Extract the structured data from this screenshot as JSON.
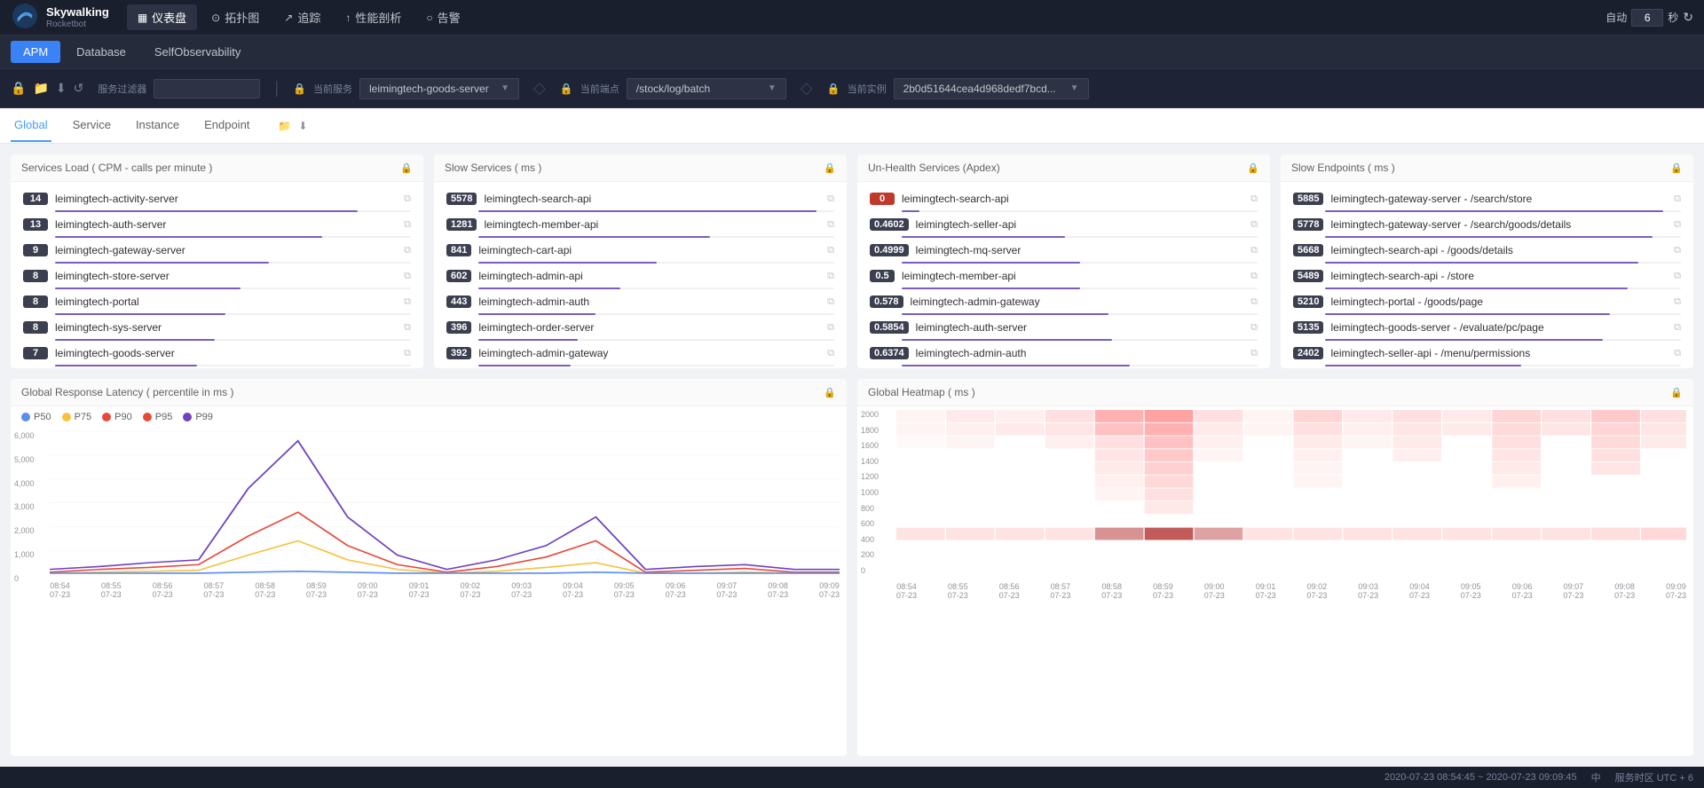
{
  "app": {
    "logo": "Skywalking",
    "logo_sub": "Rocketbot"
  },
  "top_nav": {
    "items": [
      {
        "id": "dashboard",
        "label": "仪表盘",
        "icon": "▦",
        "active": true
      },
      {
        "id": "topology",
        "label": "拓扑图",
        "icon": "⊙"
      },
      {
        "id": "trace",
        "label": "追踪",
        "icon": "↗"
      },
      {
        "id": "performance",
        "label": "性能剖析",
        "icon": "↑"
      },
      {
        "id": "alert",
        "label": "告警",
        "icon": "○"
      }
    ],
    "auto_label": "自动",
    "seconds_label": "秒",
    "refresh_label": "刷新",
    "refresh_value": "6"
  },
  "secondary_nav": {
    "items": [
      {
        "id": "apm",
        "label": "APM",
        "active": true
      },
      {
        "id": "database",
        "label": "Database"
      },
      {
        "id": "self",
        "label": "SelfObservability"
      }
    ]
  },
  "filter_bar": {
    "service_filter_label": "服务过滤器",
    "current_service_label": "当前服务",
    "current_service_value": "leimingtech-goods-server",
    "current_endpoint_label": "当前端点",
    "current_endpoint_value": "/stock/log/batch",
    "current_instance_label": "当前实例",
    "current_instance_value": "2b0d51644cea4d968dedf7bcd..."
  },
  "tabs": {
    "items": [
      {
        "id": "global",
        "label": "Global",
        "active": true
      },
      {
        "id": "service",
        "label": "Service"
      },
      {
        "id": "instance",
        "label": "Instance"
      },
      {
        "id": "endpoint",
        "label": "Endpoint"
      }
    ]
  },
  "panels": {
    "services_load": {
      "title": "Services Load ( CPM - calls per minute )",
      "services": [
        {
          "badge": "14",
          "name": "leimingtech-activity-server",
          "progress": 85
        },
        {
          "badge": "13",
          "name": "leimingtech-auth-server",
          "progress": 78
        },
        {
          "badge": "9",
          "name": "leimingtech-gateway-server",
          "progress": 65
        },
        {
          "badge": "8",
          "name": "leimingtech-store-server",
          "progress": 55
        },
        {
          "badge": "8",
          "name": "leimingtech-portal",
          "progress": 50
        },
        {
          "badge": "8",
          "name": "leimingtech-sys-server",
          "progress": 48
        },
        {
          "badge": "7",
          "name": "leimingtech-goods-server",
          "progress": 40
        }
      ]
    },
    "slow_services": {
      "title": "Slow Services ( ms )",
      "services": [
        {
          "badge": "5578",
          "name": "leimingtech-search-api",
          "progress": 95
        },
        {
          "badge": "1281",
          "name": "leimingtech-member-api",
          "progress": 65
        },
        {
          "badge": "841",
          "name": "leimingtech-cart-api",
          "progress": 50
        },
        {
          "badge": "602",
          "name": "leimingtech-admin-api",
          "progress": 42
        },
        {
          "badge": "443",
          "name": "leimingtech-admin-auth",
          "progress": 35
        },
        {
          "badge": "396",
          "name": "leimingtech-order-server",
          "progress": 30
        },
        {
          "badge": "392",
          "name": "leimingtech-admin-gateway",
          "progress": 28
        }
      ]
    },
    "unhealth_services": {
      "title": "Un-Health Services (Apdex)",
      "services": [
        {
          "badge": "0",
          "name": "leimingtech-search-api",
          "progress": 5,
          "badge_color": "#c0392b"
        },
        {
          "badge": "0.4602",
          "name": "leimingtech-seller-api",
          "progress": 46
        },
        {
          "badge": "0.4999",
          "name": "leimingtech-mq-server",
          "progress": 50
        },
        {
          "badge": "0.5",
          "name": "leimingtech-member-api",
          "progress": 50
        },
        {
          "badge": "0.578",
          "name": "leimingtech-admin-gateway",
          "progress": 58
        },
        {
          "badge": "0.5854",
          "name": "leimingtech-auth-server",
          "progress": 59
        },
        {
          "badge": "0.6374",
          "name": "leimingtech-admin-auth",
          "progress": 64
        }
      ]
    },
    "slow_endpoints": {
      "title": "Slow Endpoints ( ms )",
      "services": [
        {
          "badge": "5885",
          "name": "leimingtech-gateway-server - /search/store",
          "progress": 95
        },
        {
          "badge": "5778",
          "name": "leimingtech-gateway-server - /search/goods/details",
          "progress": 90
        },
        {
          "badge": "5668",
          "name": "leimingtech-search-api - /goods/details",
          "progress": 88
        },
        {
          "badge": "5489",
          "name": "leimingtech-search-api - /store",
          "progress": 85
        },
        {
          "badge": "5210",
          "name": "leimingtech-portal - /goods/page",
          "progress": 80
        },
        {
          "badge": "5135",
          "name": "leimingtech-goods-server - /evaluate/pc/page",
          "progress": 78
        },
        {
          "badge": "2402",
          "name": "leimingtech-seller-api - /menu/permissions",
          "progress": 55
        }
      ]
    }
  },
  "latency_chart": {
    "title": "Global Response Latency ( percentile in ms )",
    "legend": [
      {
        "label": "P50",
        "color": "#5b8dee"
      },
      {
        "label": "P75",
        "color": "#f6c23e"
      },
      {
        "label": "P90",
        "color": "#e74a3b"
      },
      {
        "label": "P95",
        "color": "#e74a3b"
      },
      {
        "label": "P99",
        "color": "#6f42c1"
      }
    ],
    "y_labels": [
      "6,000",
      "5,000",
      "4,000",
      "3,000",
      "2,000",
      "1,000",
      "0"
    ],
    "x_labels": [
      "08:54\n07-23",
      "08:55\n07-23",
      "08:56\n07-23",
      "08:57\n07-23",
      "08:58\n07-23",
      "08:59\n07-23",
      "09:00\n07-23",
      "09:01\n07-23",
      "09:02\n07-23",
      "09:03\n07-23",
      "09:04\n07-23",
      "09:05\n07-23",
      "09:06\n07-23",
      "09:07\n07-23",
      "09:08\n07-23",
      "09:09\n07-23"
    ]
  },
  "heatmap_chart": {
    "title": "Global Heatmap ( ms )",
    "y_labels": [
      "2000",
      "1800",
      "1600",
      "1400",
      "1200",
      "1000",
      "800",
      "600",
      "400",
      "200",
      "0"
    ],
    "x_labels": [
      "08:54\n07-23",
      "08:55\n07-23",
      "08:56\n07-23",
      "08:57\n07-23",
      "08:58\n07-23",
      "08:59\n07-23",
      "09:00\n07-23",
      "09:01\n07-23",
      "09:02\n07-23",
      "09:03\n07-23",
      "09:04\n07-23",
      "09:05\n07-23",
      "09:06\n07-23",
      "09:07\n07-23",
      "09:08\n07-23",
      "09:09\n07-23"
    ]
  },
  "bottom_bar": {
    "timezone": "中",
    "timezone_label": "服务时区 UTC + 6",
    "time_range": "2020-07-23 08:54:45 ~ 2020-07-23 09:09:45"
  }
}
